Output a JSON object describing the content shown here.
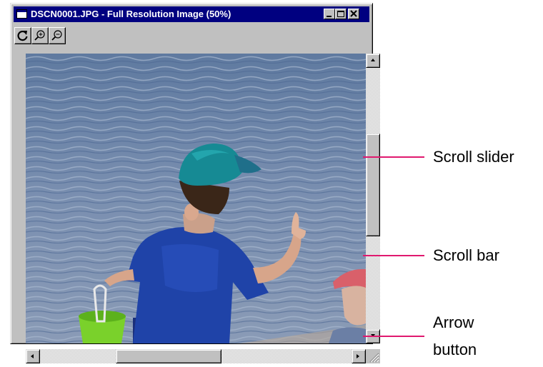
{
  "window": {
    "title": "DSCN0001.JPG - Full Resolution Image (50%)",
    "title_bar_color": "#000080",
    "title_text_color": "#ffffff",
    "controls": [
      {
        "name": "minimize",
        "icon": "minimize-icon"
      },
      {
        "name": "maximize",
        "icon": "maximize-icon"
      },
      {
        "name": "close",
        "icon": "close-icon"
      }
    ]
  },
  "toolbar": {
    "buttons": [
      {
        "name": "rotate",
        "icon": "rotate-icon"
      },
      {
        "name": "zoom-in",
        "icon": "zoom-in-icon"
      },
      {
        "name": "zoom-out",
        "icon": "zoom-out-icon"
      }
    ]
  },
  "image": {
    "subject": "photo",
    "colors": {
      "water": "#6f86a8",
      "shirt": "#1d3fa6",
      "cap": "#138a93",
      "bucket": "#7ad12b"
    }
  },
  "scrollbars": {
    "vertical": {
      "position_fraction": 0.44,
      "visible_fraction": 0.37
    },
    "horizontal": {
      "position_fraction": 0.27,
      "visible_fraction": 0.33
    },
    "icons": [
      "arrow-up-icon",
      "arrow-down-icon",
      "arrow-left-icon",
      "arrow-right-icon",
      "size-grip-icon"
    ]
  },
  "annotations": {
    "color": "#e0196f",
    "scroll_slider": "Scroll slider",
    "scroll_bar": "Scroll bar",
    "arrow_button_line1": "Arrow",
    "arrow_button_line2": "button"
  }
}
